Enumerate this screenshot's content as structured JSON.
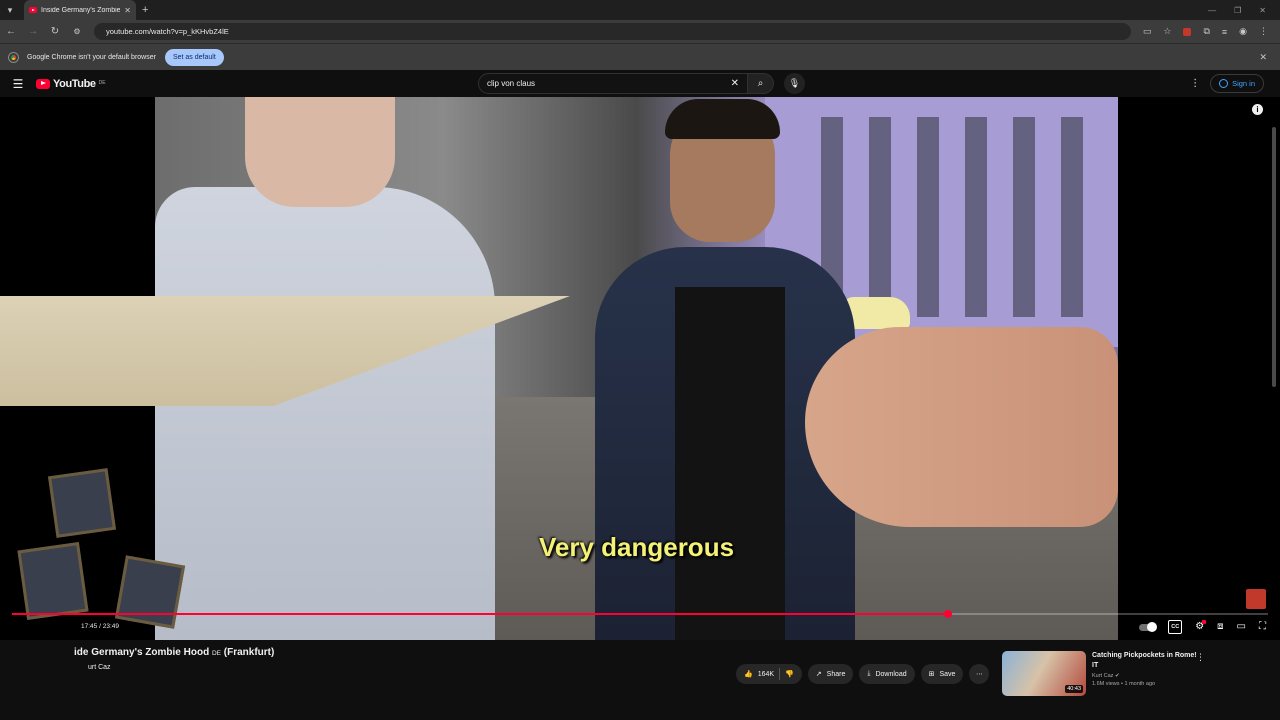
{
  "browser": {
    "tab_title": "Inside Germany's Zombie Hood",
    "url": "youtube.com/watch?v=p_kKHvbZ4lE",
    "infobar_text": "Google Chrome isn't your default browser",
    "infobar_button": "Set as default"
  },
  "youtube": {
    "logo_text": "YouTube",
    "country": "DE",
    "search_value": "clip von claus",
    "sign_in": "Sign in"
  },
  "player": {
    "subtitle": "Very dangerous",
    "current_time": "17:45",
    "duration": "23:49",
    "progress_fraction": 0.745
  },
  "video": {
    "title_main": "ide Germany's Zombie Hood",
    "title_badge": "DE",
    "title_suffix": "(Frankfurt)",
    "channel": "urt Caz",
    "likes": "164K",
    "share": "Share",
    "download": "Download",
    "save": "Save"
  },
  "recommendation": {
    "title": "Catching Pickpockets in Rome!",
    "title_extra": "IT",
    "channel": "Kurt Caz",
    "meta": "1.6M views • 1 month ago",
    "duration": "40:43"
  }
}
